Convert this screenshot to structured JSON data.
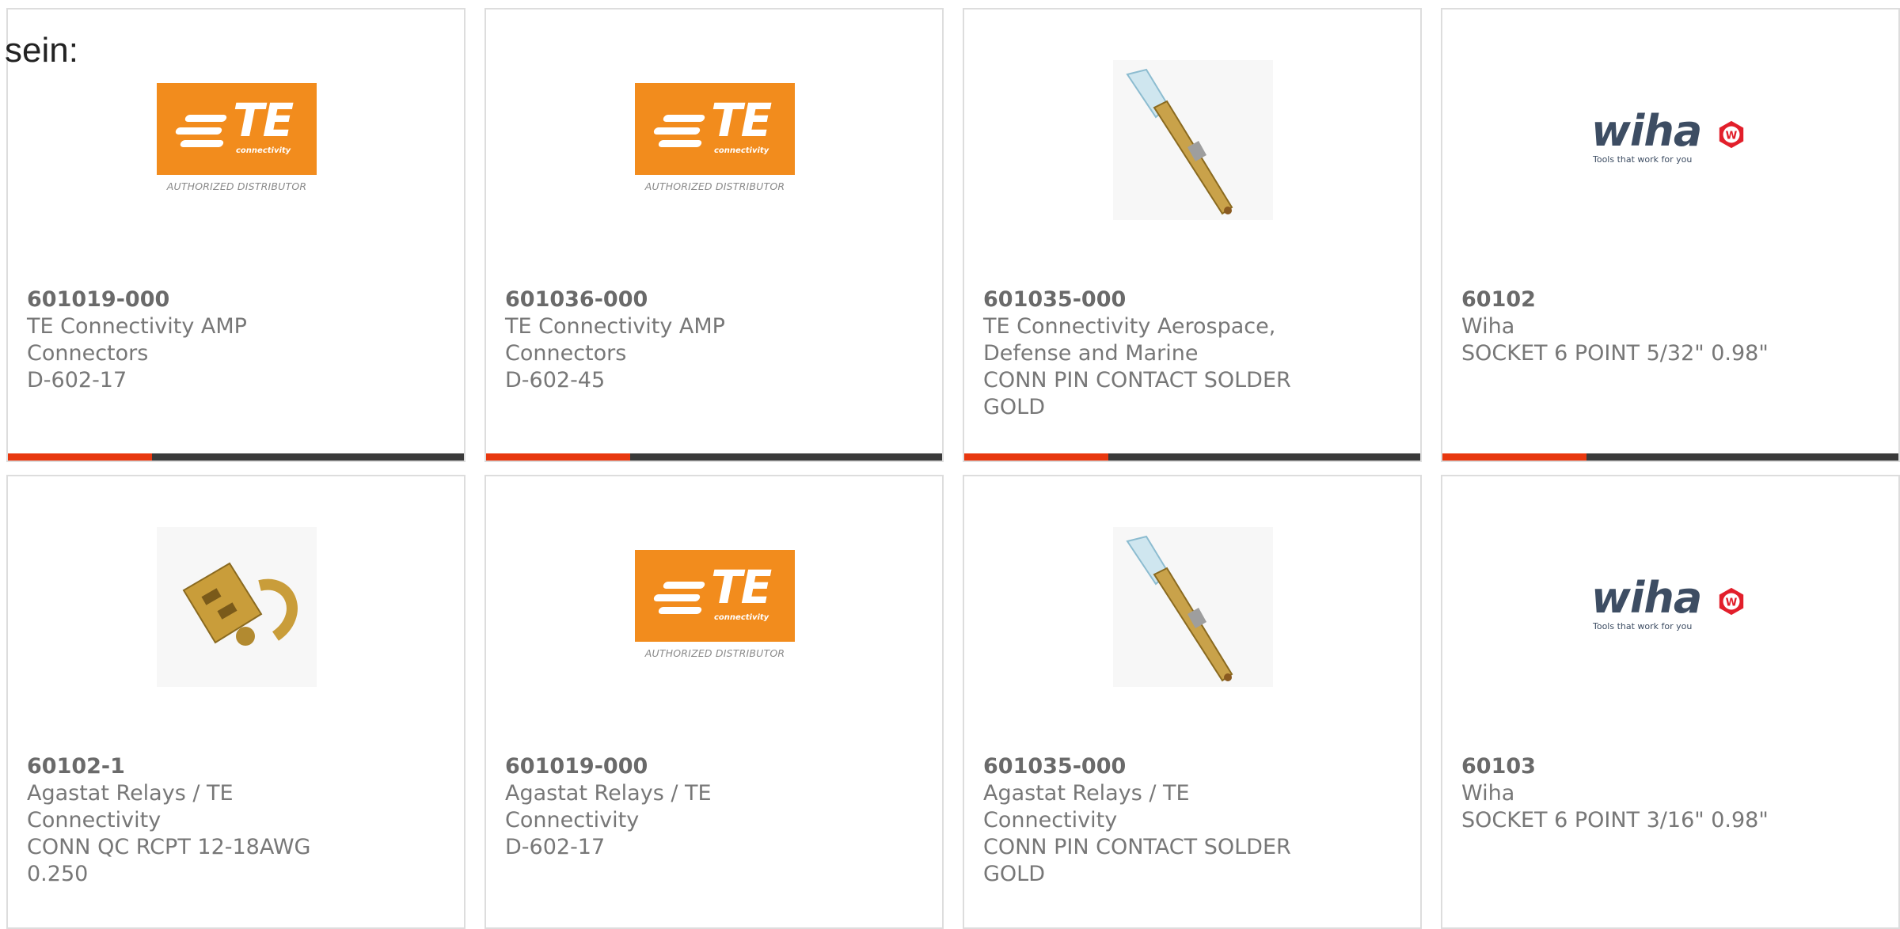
{
  "intro_text": "sein:",
  "logo_text": {
    "te_mark": "TE",
    "te_sub": "connectivity",
    "te_caption": "AUTHORIZED DISTRIBUTOR",
    "wiha_word": "wiha",
    "wiha_tag": "Tools that work for you"
  },
  "colors": {
    "accent_bar": "#e8380f",
    "bar_base": "#3a3a3a",
    "te_orange": "#f28c1d"
  },
  "products": [
    {
      "part_number": "601019-000",
      "manufacturer": "TE Connectivity AMP Connectors",
      "description": "D-602-17",
      "image": "te-connectivity-logo"
    },
    {
      "part_number": "601036-000",
      "manufacturer": "TE Connectivity AMP Connectors",
      "description": "D-602-45",
      "image": "te-connectivity-logo"
    },
    {
      "part_number": "601035-000",
      "manufacturer": "TE Connectivity Aerospace, Defense and Marine",
      "description": "CONN PIN CONTACT SOLDER GOLD",
      "image": "pin-contact-photo"
    },
    {
      "part_number": "60102",
      "manufacturer": "Wiha",
      "description": "SOCKET 6 POINT 5/32\" 0.98\"",
      "image": "wiha-logo"
    },
    {
      "part_number": "60102-1",
      "manufacturer": "Agastat Relays / TE Connectivity",
      "description": "CONN QC RCPT 12-18AWG 0.250",
      "image": "quick-connect-photo"
    },
    {
      "part_number": "601019-000",
      "manufacturer": "Agastat Relays / TE Connectivity",
      "description": "D-602-17",
      "image": "te-connectivity-logo"
    },
    {
      "part_number": "601035-000",
      "manufacturer": "Agastat Relays / TE Connectivity",
      "description": "CONN PIN CONTACT SOLDER GOLD",
      "image": "pin-contact-photo"
    },
    {
      "part_number": "60103",
      "manufacturer": "Wiha",
      "description": "SOCKET 6 POINT 3/16\" 0.98\"",
      "image": "wiha-logo"
    }
  ]
}
